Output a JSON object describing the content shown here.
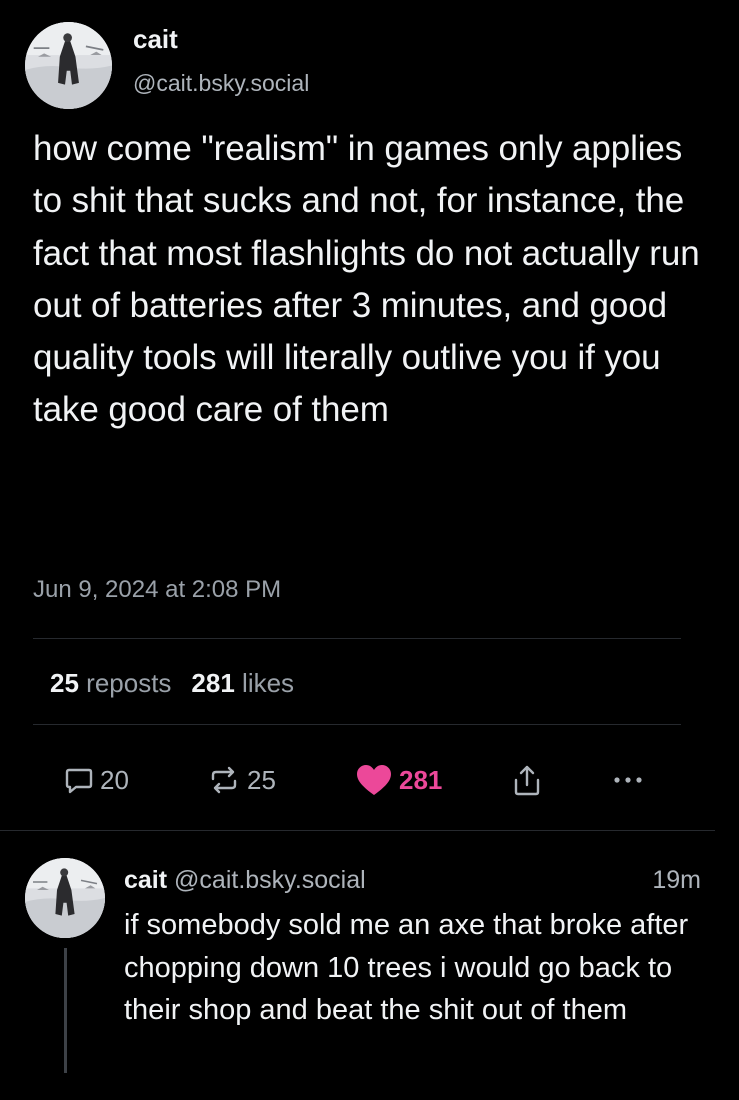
{
  "post": {
    "author_name": "cait",
    "author_handle": "@cait.bsky.social",
    "text": "how come \"realism\" in games only applies to shit that sucks and not, for instance, the fact that most flashlights do not actually run out of batteries after 3 minutes, and good quality tools will literally outlive you if you take good care of them",
    "timestamp": "Jun 9, 2024 at 2:08 PM",
    "repost_count": "25",
    "repost_label": "reposts",
    "like_count": "281",
    "like_label": "likes"
  },
  "actions": {
    "reply_icon": "reply-bubble-icon",
    "reply_count": "20",
    "repost_icon": "repost-arrows-icon",
    "repost_count": "25",
    "like_icon": "heart-icon",
    "like_count": "281",
    "share_icon": "share-upload-icon",
    "more_icon": "ellipsis-icon"
  },
  "reply": {
    "author_name": "cait",
    "author_handle": "@cait.bsky.social",
    "time_ago": "19m",
    "text": "if somebody sold me an axe that broke after chopping down 10 trees i would go back to their shop and beat the shit out of them"
  },
  "colors": {
    "background": "#000000",
    "text": "#f1f3f5",
    "muted": "#9aa1a9",
    "like_accent": "#ec4899",
    "divider": "#26292e"
  }
}
